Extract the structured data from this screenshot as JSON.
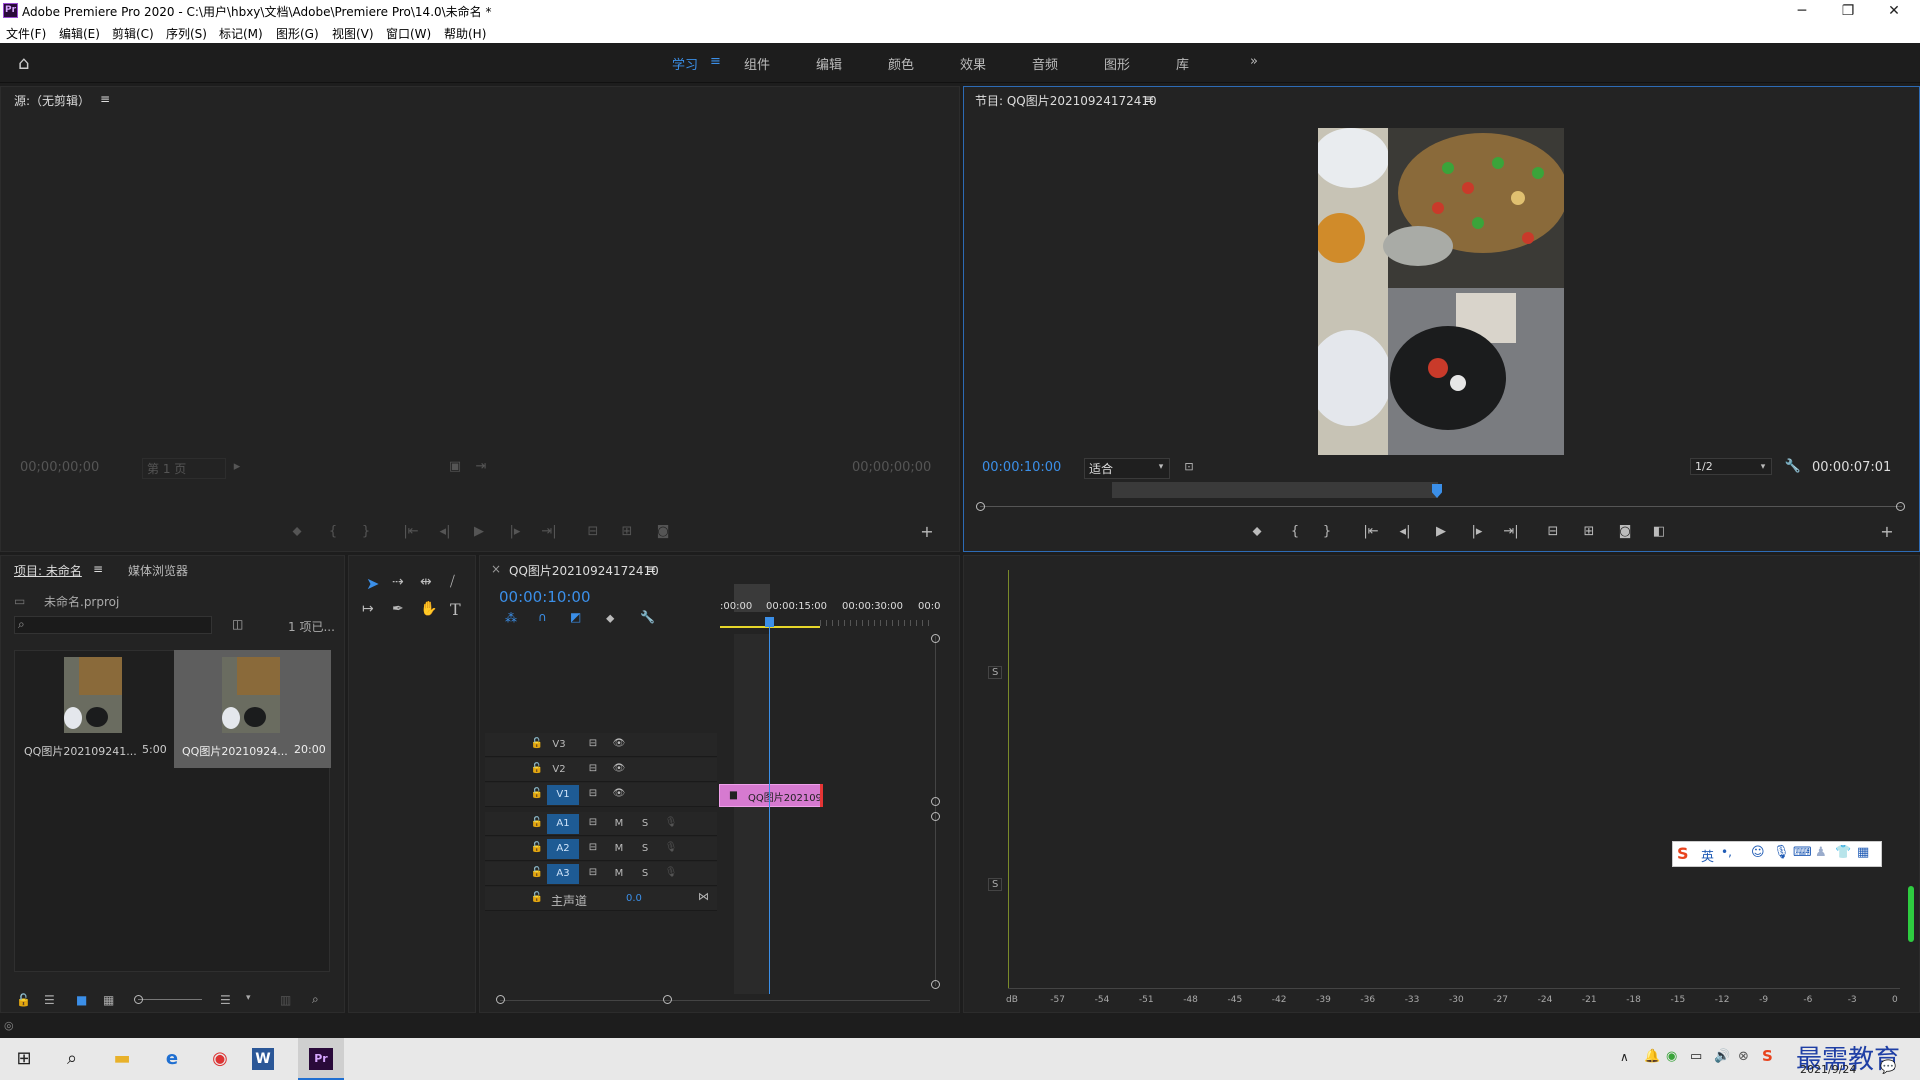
{
  "window": {
    "title": "Adobe Premiere Pro 2020 - C:\\用户\\hbxy\\文档\\Adobe\\Premiere Pro\\14.0\\未命名 *",
    "app_icon": "Pr"
  },
  "menu": [
    "文件(F)",
    "编辑(E)",
    "剪辑(C)",
    "序列(S)",
    "标记(M)",
    "图形(G)",
    "视图(V)",
    "窗口(W)",
    "帮助(H)"
  ],
  "workspaces": {
    "items": [
      "学习",
      "组件",
      "编辑",
      "颜色",
      "效果",
      "音频",
      "图形",
      "库"
    ],
    "active": "学习",
    "more": "»"
  },
  "source": {
    "title": "源:（无剪辑）",
    "timecode_left": "00;00;00;00",
    "page": "第 1 页",
    "timecode_right": "00;00;00;00"
  },
  "program": {
    "title": "节目: QQ图片20210924172410",
    "timecode": "00:00:10:00",
    "fit": "适合",
    "resolution": "1/2",
    "duration": "00:00:07:01"
  },
  "project": {
    "tab_active": "项目: 未命名",
    "tab_other": "媒体浏览器",
    "file": "未命名.prproj",
    "count": "1 项已...",
    "items": [
      {
        "name": "QQ图片202109241...",
        "duration": "5:00"
      },
      {
        "name": "QQ图片20210924...",
        "duration": "20:00"
      }
    ]
  },
  "timeline": {
    "title": "QQ图片20210924172410",
    "timecode": "00:00:10:00",
    "ruler": [
      ":00:00",
      "00:00:15:00",
      "00:00:30:00",
      "00:0"
    ],
    "tracks": [
      {
        "label": "V3",
        "type": "video"
      },
      {
        "label": "V2",
        "type": "video"
      },
      {
        "label": "V1",
        "type": "video"
      },
      {
        "label": "A1",
        "type": "audio"
      },
      {
        "label": "A2",
        "type": "audio"
      },
      {
        "label": "A3",
        "type": "audio"
      }
    ],
    "master": "主声道",
    "master_value": "0.0",
    "clip": "QQ图片202109",
    "btn_m": "M",
    "btn_s": "S"
  },
  "meter": {
    "labels": [
      "dB",
      "-57",
      "-54",
      "-51",
      "-48",
      "-45",
      "-42",
      "-39",
      "-36",
      "-33",
      "-30",
      "-27",
      "-24",
      "-21",
      "-18",
      "-15",
      "-12",
      "-9",
      "-6",
      "-3",
      "0"
    ],
    "s_label": "S"
  },
  "ime": {
    "text": "英"
  },
  "taskbar": {
    "date": "2021/9/24",
    "watermark": "最需教育"
  },
  "colors": {
    "accent": "#3b8fe8",
    "clip": "#d67ad0",
    "track_label": "#1e5b94"
  }
}
